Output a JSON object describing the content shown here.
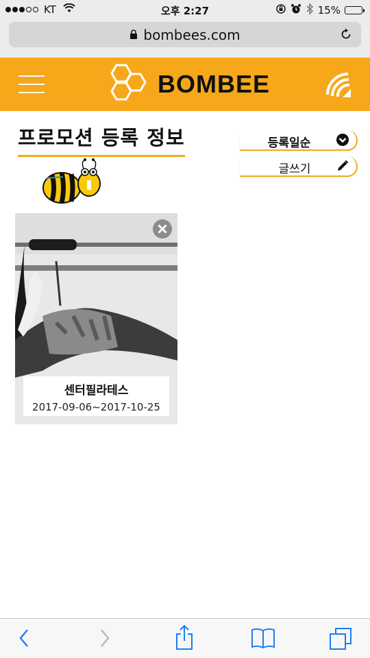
{
  "status_bar": {
    "carrier": "KT",
    "time": "오후 2:27",
    "battery_percent": "15%",
    "battery_level": 0.15,
    "signal_bars_filled": 3,
    "signal_bars_total": 5
  },
  "browser": {
    "url": "bombees.com"
  },
  "header": {
    "brand_name": "BOMBEE"
  },
  "content": {
    "page_title": "프로모션 등록 정보",
    "sort_label": "등록일순",
    "write_label": "글쓰기"
  },
  "cards": [
    {
      "title": "센터필라테스",
      "date_range": "2017-09-06~2017-10-25"
    }
  ],
  "colors": {
    "brand_yellow": "#f6a81a",
    "header_text": "#111111"
  },
  "icons": [
    "wifi-icon",
    "alarm-icon",
    "rotation-lock-icon",
    "bluetooth-icon",
    "lock-icon",
    "reload-icon",
    "menu-icon",
    "honeycomb-logo-icon",
    "brand-mark-icon",
    "chevron-down-circle-icon",
    "pencil-icon",
    "bee-mascot-icon",
    "close-circle-icon",
    "back-icon",
    "forward-icon",
    "share-icon",
    "bookmarks-icon",
    "tabs-icon"
  ]
}
